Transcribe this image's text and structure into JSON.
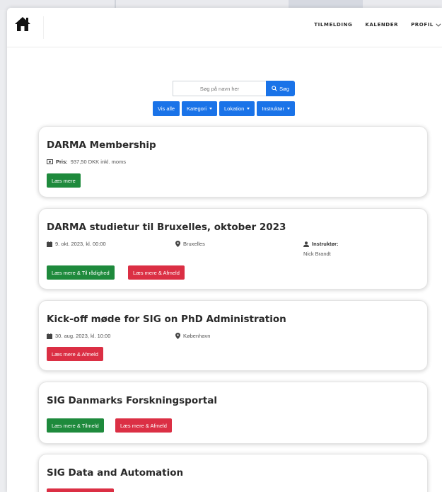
{
  "nav": {
    "items": [
      "TILMELDING",
      "KALENDER",
      "PROFIL"
    ]
  },
  "search": {
    "placeholder": "Søg på navn her",
    "button_label": "Søg"
  },
  "filters": [
    "Vis alle",
    "Kategori",
    "Lokation",
    "Instruktør"
  ],
  "events": [
    {
      "title": "DARMA Membership",
      "price_label": "Pris:",
      "price_value": "937,50 DKK inkl. moms",
      "buttons": [
        "Læs mere"
      ]
    },
    {
      "title": "DARMA studietur til Bruxelles, oktober 2023",
      "date": "9. okt. 2023, kl. 00:00",
      "location": "Bruxelles",
      "instructor_label": "Instruktør:",
      "instructor_name": "Nick Brandt",
      "buttons": [
        "Læs mere & Til rådighed",
        "Læs mere & Afmeld"
      ]
    },
    {
      "title": "Kick-off møde for SIG on PhD Administration",
      "date": "30. aug. 2023, kl. 10:00",
      "location": "København",
      "buttons": [
        "Læs mere & Afmeld"
      ]
    },
    {
      "title": "SIG Danmarks Forskningsportal",
      "buttons": [
        "Læs mere & Tilmeld",
        "Læs mere & Afmeld"
      ]
    },
    {
      "title": "SIG Data and Automation"
    }
  ],
  "colors": {
    "primary": "#1a73e8",
    "success": "#1e8a3c",
    "danger": "#db2f44"
  }
}
